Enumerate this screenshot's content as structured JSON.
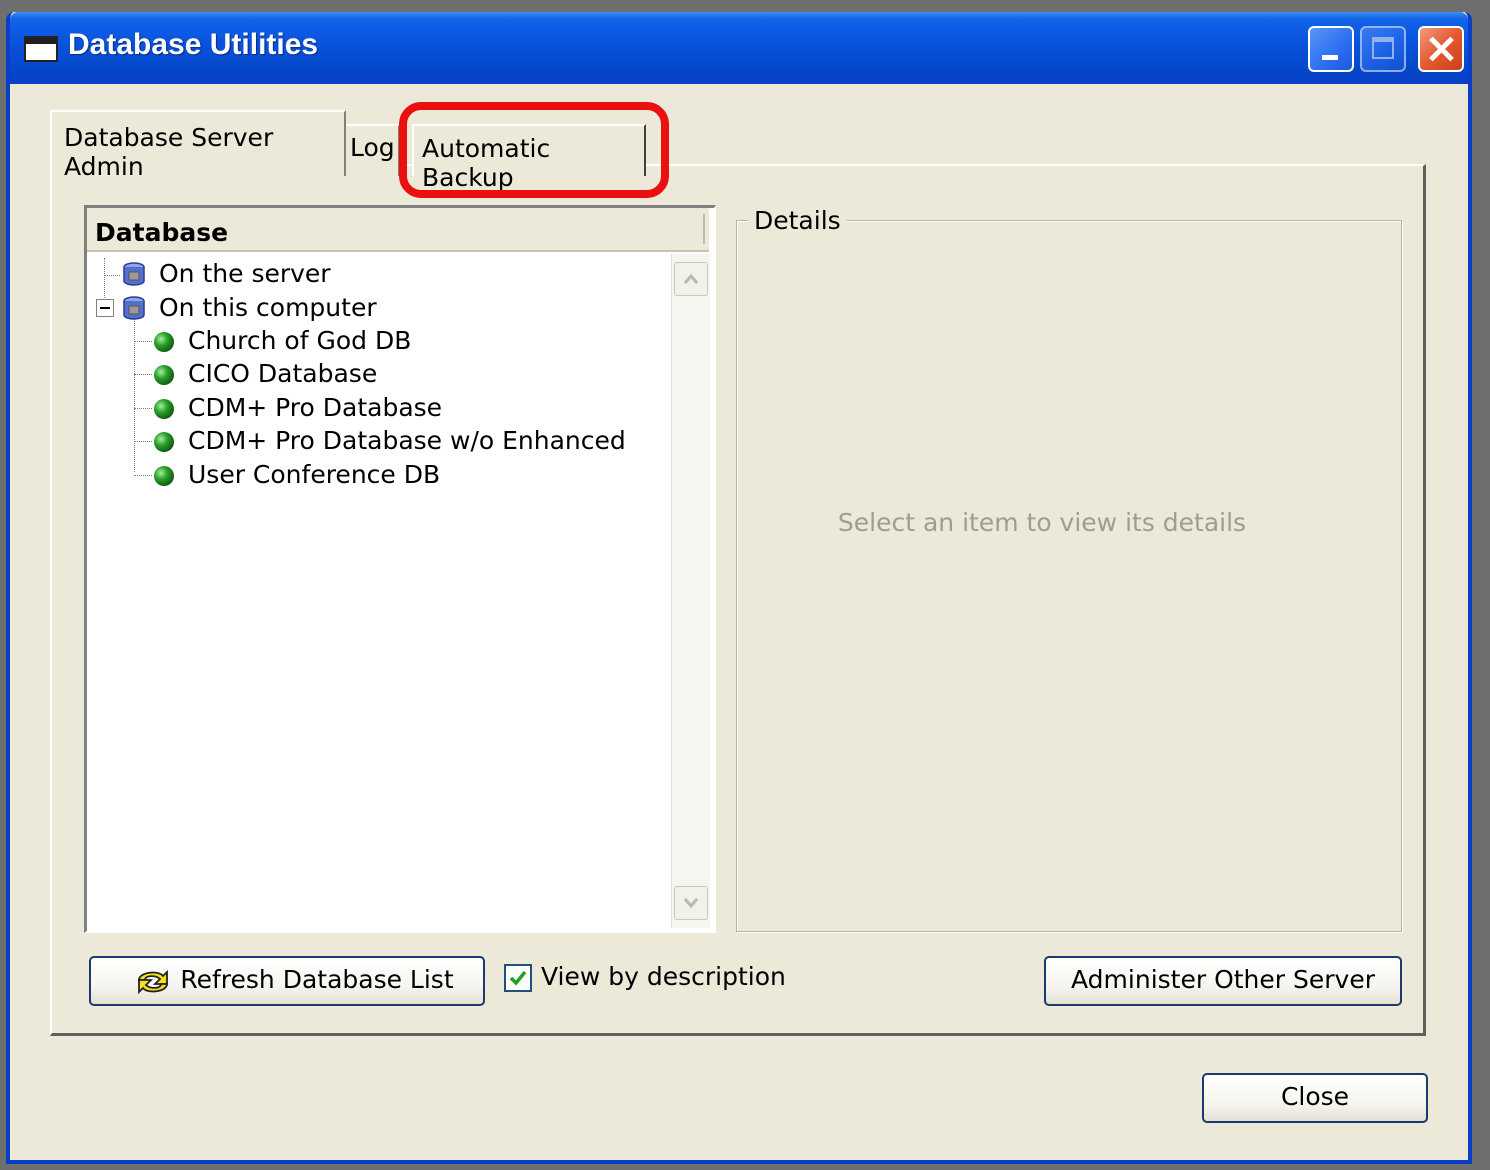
{
  "window": {
    "title": "Database Utilities"
  },
  "tabs": [
    {
      "label": "Database Server Admin",
      "active": true
    },
    {
      "label": "Log",
      "active": false
    },
    {
      "label": "Automatic Backup",
      "active": false,
      "highlighted": true
    }
  ],
  "tree": {
    "header": "Database",
    "items": [
      {
        "label": "On the server",
        "level": 0,
        "icon": "database-icon"
      },
      {
        "label": "On this computer",
        "level": 0,
        "icon": "database-icon",
        "expanded": true
      },
      {
        "label": "Church of God DB",
        "level": 1,
        "icon": "green-ball-icon"
      },
      {
        "label": "CICO Database",
        "level": 1,
        "icon": "green-ball-icon"
      },
      {
        "label": "CDM+ Pro Database",
        "level": 1,
        "icon": "green-ball-icon"
      },
      {
        "label": "CDM+ Pro Database w/o Enhanced",
        "level": 1,
        "icon": "green-ball-icon"
      },
      {
        "label": "User Conference DB",
        "level": 1,
        "icon": "green-ball-icon"
      }
    ]
  },
  "details": {
    "legend": "Details",
    "empty_message": "Select an item to view its details"
  },
  "controls": {
    "refresh_label": "Refresh Database List",
    "view_by_description_label": "View by description",
    "view_by_description_checked": true,
    "administer_label": "Administer Other Server",
    "close_label": "Close"
  },
  "colors": {
    "titlebar": "#0a52dc",
    "highlight": "#ea1010",
    "face": "#ece9d8"
  }
}
